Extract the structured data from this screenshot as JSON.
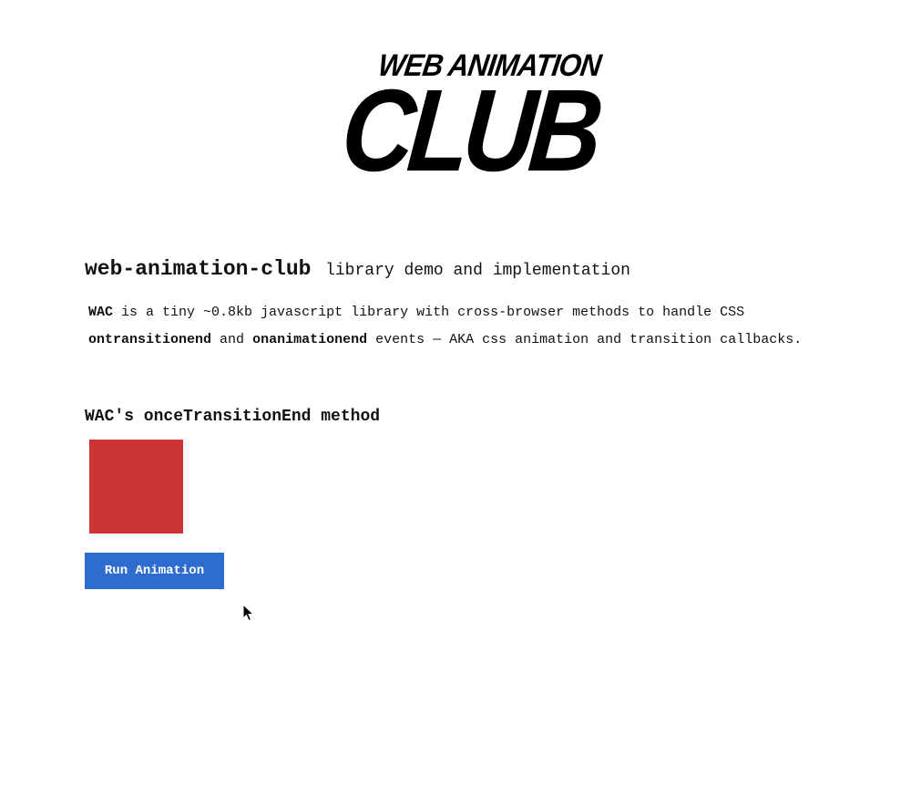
{
  "logo": {
    "line1": "WEB ANIMATION",
    "line2": "CLUB"
  },
  "headline": {
    "lib_name": "web-animation-club",
    "lib_desc": "library demo and implementation"
  },
  "intro": {
    "wac": "WAC",
    "text1": "is a tiny ~0.8kb javascript library with cross-browser methods to handle CSS",
    "transition_event": "ontransitionend",
    "and": "and",
    "animation_event": "onanimationend",
    "text2": "events — AKA css animation and transition callbacks."
  },
  "section": {
    "title": "WAC's onceTransitionEnd method"
  },
  "demo": {
    "box_color": "#cc3333",
    "button_label": "Run Animation",
    "button_color": "#2f6ccf"
  },
  "icons": {
    "cursor": "mouse-pointer-icon"
  }
}
